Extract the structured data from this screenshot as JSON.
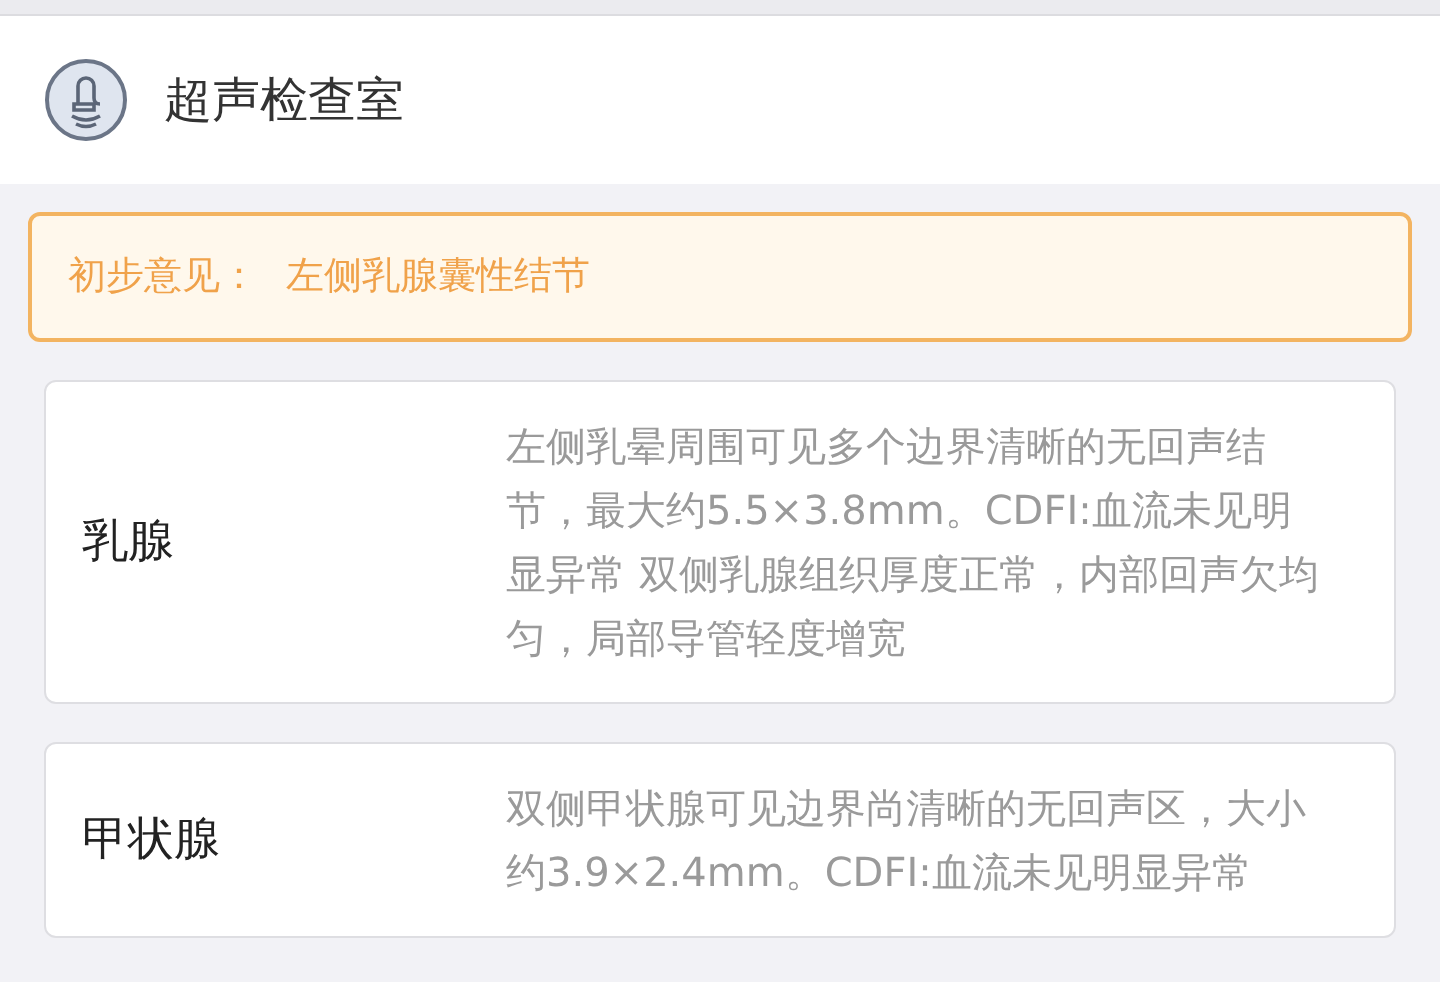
{
  "header": {
    "title": "超声检查室"
  },
  "opinion": {
    "label": "初步意见：",
    "value": "左侧乳腺囊性结节"
  },
  "findings": [
    {
      "organ": "乳腺",
      "description": "左侧乳晕周围可见多个边界清晰的无回声结节，最大约5.5×3.8mm。CDFI:血流未见明显异常 双侧乳腺组织厚度正常，内部回声欠均匀，局部导管轻度增宽"
    },
    {
      "organ": "甲状腺",
      "description": "双侧甲状腺可见边界尚清晰的无回声区，大小约3.9×2.4mm。CDFI:血流未见明显异常"
    }
  ]
}
